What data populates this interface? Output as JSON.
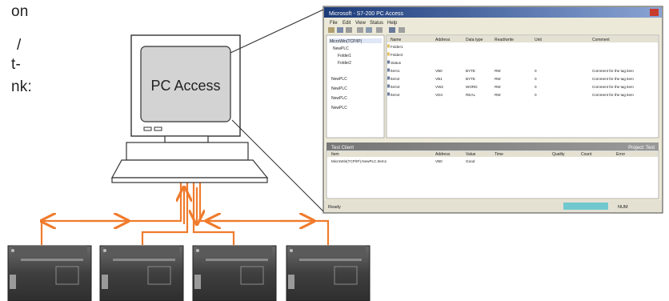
{
  "left_text_fragments": [
    "on",
    "/",
    "t-",
    "nk:"
  ],
  "monitor": {
    "label": "PC Access"
  },
  "screenshot_window": {
    "title": "Microsoft - S7-200 PC Access",
    "menu": [
      "File",
      "Edit",
      "View",
      "Status",
      "Help"
    ],
    "table_columns": [
      "Name",
      "Address",
      "Data type",
      "Read/write",
      "Unit",
      "Comment"
    ],
    "tree_items": [
      "MicroWin(TCP/IP)",
      "NewPLC",
      "Folder1",
      "Folder2",
      "NewPLC",
      "NewPLC",
      "NewPLC",
      "NewPLC"
    ],
    "table_rows": [
      [
        "Folder1",
        "",
        "",
        "",
        "",
        ""
      ],
      [
        "Folder2",
        "",
        "",
        "",
        "",
        ""
      ],
      [
        "Status",
        "",
        "",
        "",
        "",
        ""
      ],
      [
        "Item1",
        "VB0",
        "BYTE",
        "RW",
        "0",
        "Comment for the tag item"
      ],
      [
        "Item2",
        "VB1",
        "BYTE",
        "RW",
        "0",
        "Comment for the tag item"
      ],
      [
        "Item3",
        "VW2",
        "WORD",
        "RW",
        "0",
        "Comment for the tag item"
      ],
      [
        "Item4",
        "VD4",
        "REAL",
        "RW",
        "0",
        "Comment for the tag item"
      ]
    ],
    "lower_panel_title": "Test Client",
    "lower_panel_right": "Project: Test",
    "lower_columns": [
      "Item",
      "Address",
      "Value",
      "Time",
      "Quality",
      "Count",
      "Error"
    ],
    "lower_rows": [
      [
        "MicroWin(TCP/IP).NewPLC.Item1",
        "VB0",
        "Good",
        "",
        "",
        "",
        ""
      ]
    ],
    "status_left": "Ready",
    "status_right": "NUM"
  },
  "colors": {
    "connection": "#f07b2c",
    "window_title": "#1d3d7a",
    "plc_body": "#4b4b4b",
    "monitor_screen": "#d3d3d3"
  },
  "icons": [
    "pc-monitor",
    "plc-module",
    "arrow-left",
    "arrow-right",
    "arrow-up",
    "arrow-down"
  ]
}
